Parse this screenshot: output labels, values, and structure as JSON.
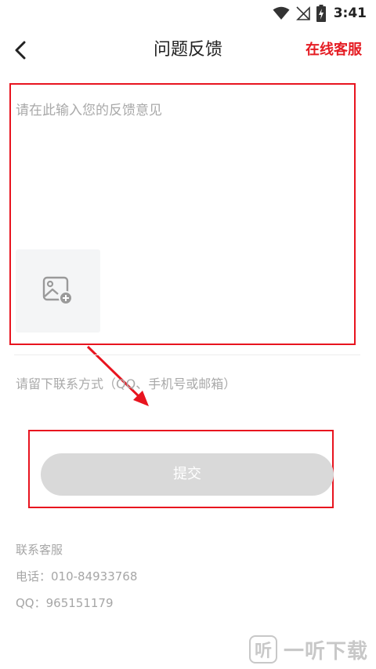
{
  "status_bar": {
    "time": "3:41",
    "icons": [
      "wifi-icon",
      "no-signal-icon",
      "battery-charging-icon"
    ]
  },
  "header": {
    "back_icon": "chevron-left-icon",
    "title": "问题反馈",
    "online_service": "在线客服"
  },
  "feedback": {
    "placeholder": "请在此输入您的反馈意见",
    "value": "",
    "add_image_icon": "add-image-icon"
  },
  "contact": {
    "placeholder": "请留下联系方式（QQ、手机号或邮箱）",
    "value": ""
  },
  "submit": {
    "label": "提交"
  },
  "service_info": {
    "title": "联系客服",
    "phone": "电话：010-84933768",
    "qq": "QQ：965151179"
  },
  "watermark": {
    "logo_char": "听",
    "text": "一听下载"
  },
  "colors": {
    "highlight": "#e8141f",
    "accent": "#e51c23",
    "button_disabled": "#d9d9d9",
    "placeholder": "#a9a9a9"
  }
}
